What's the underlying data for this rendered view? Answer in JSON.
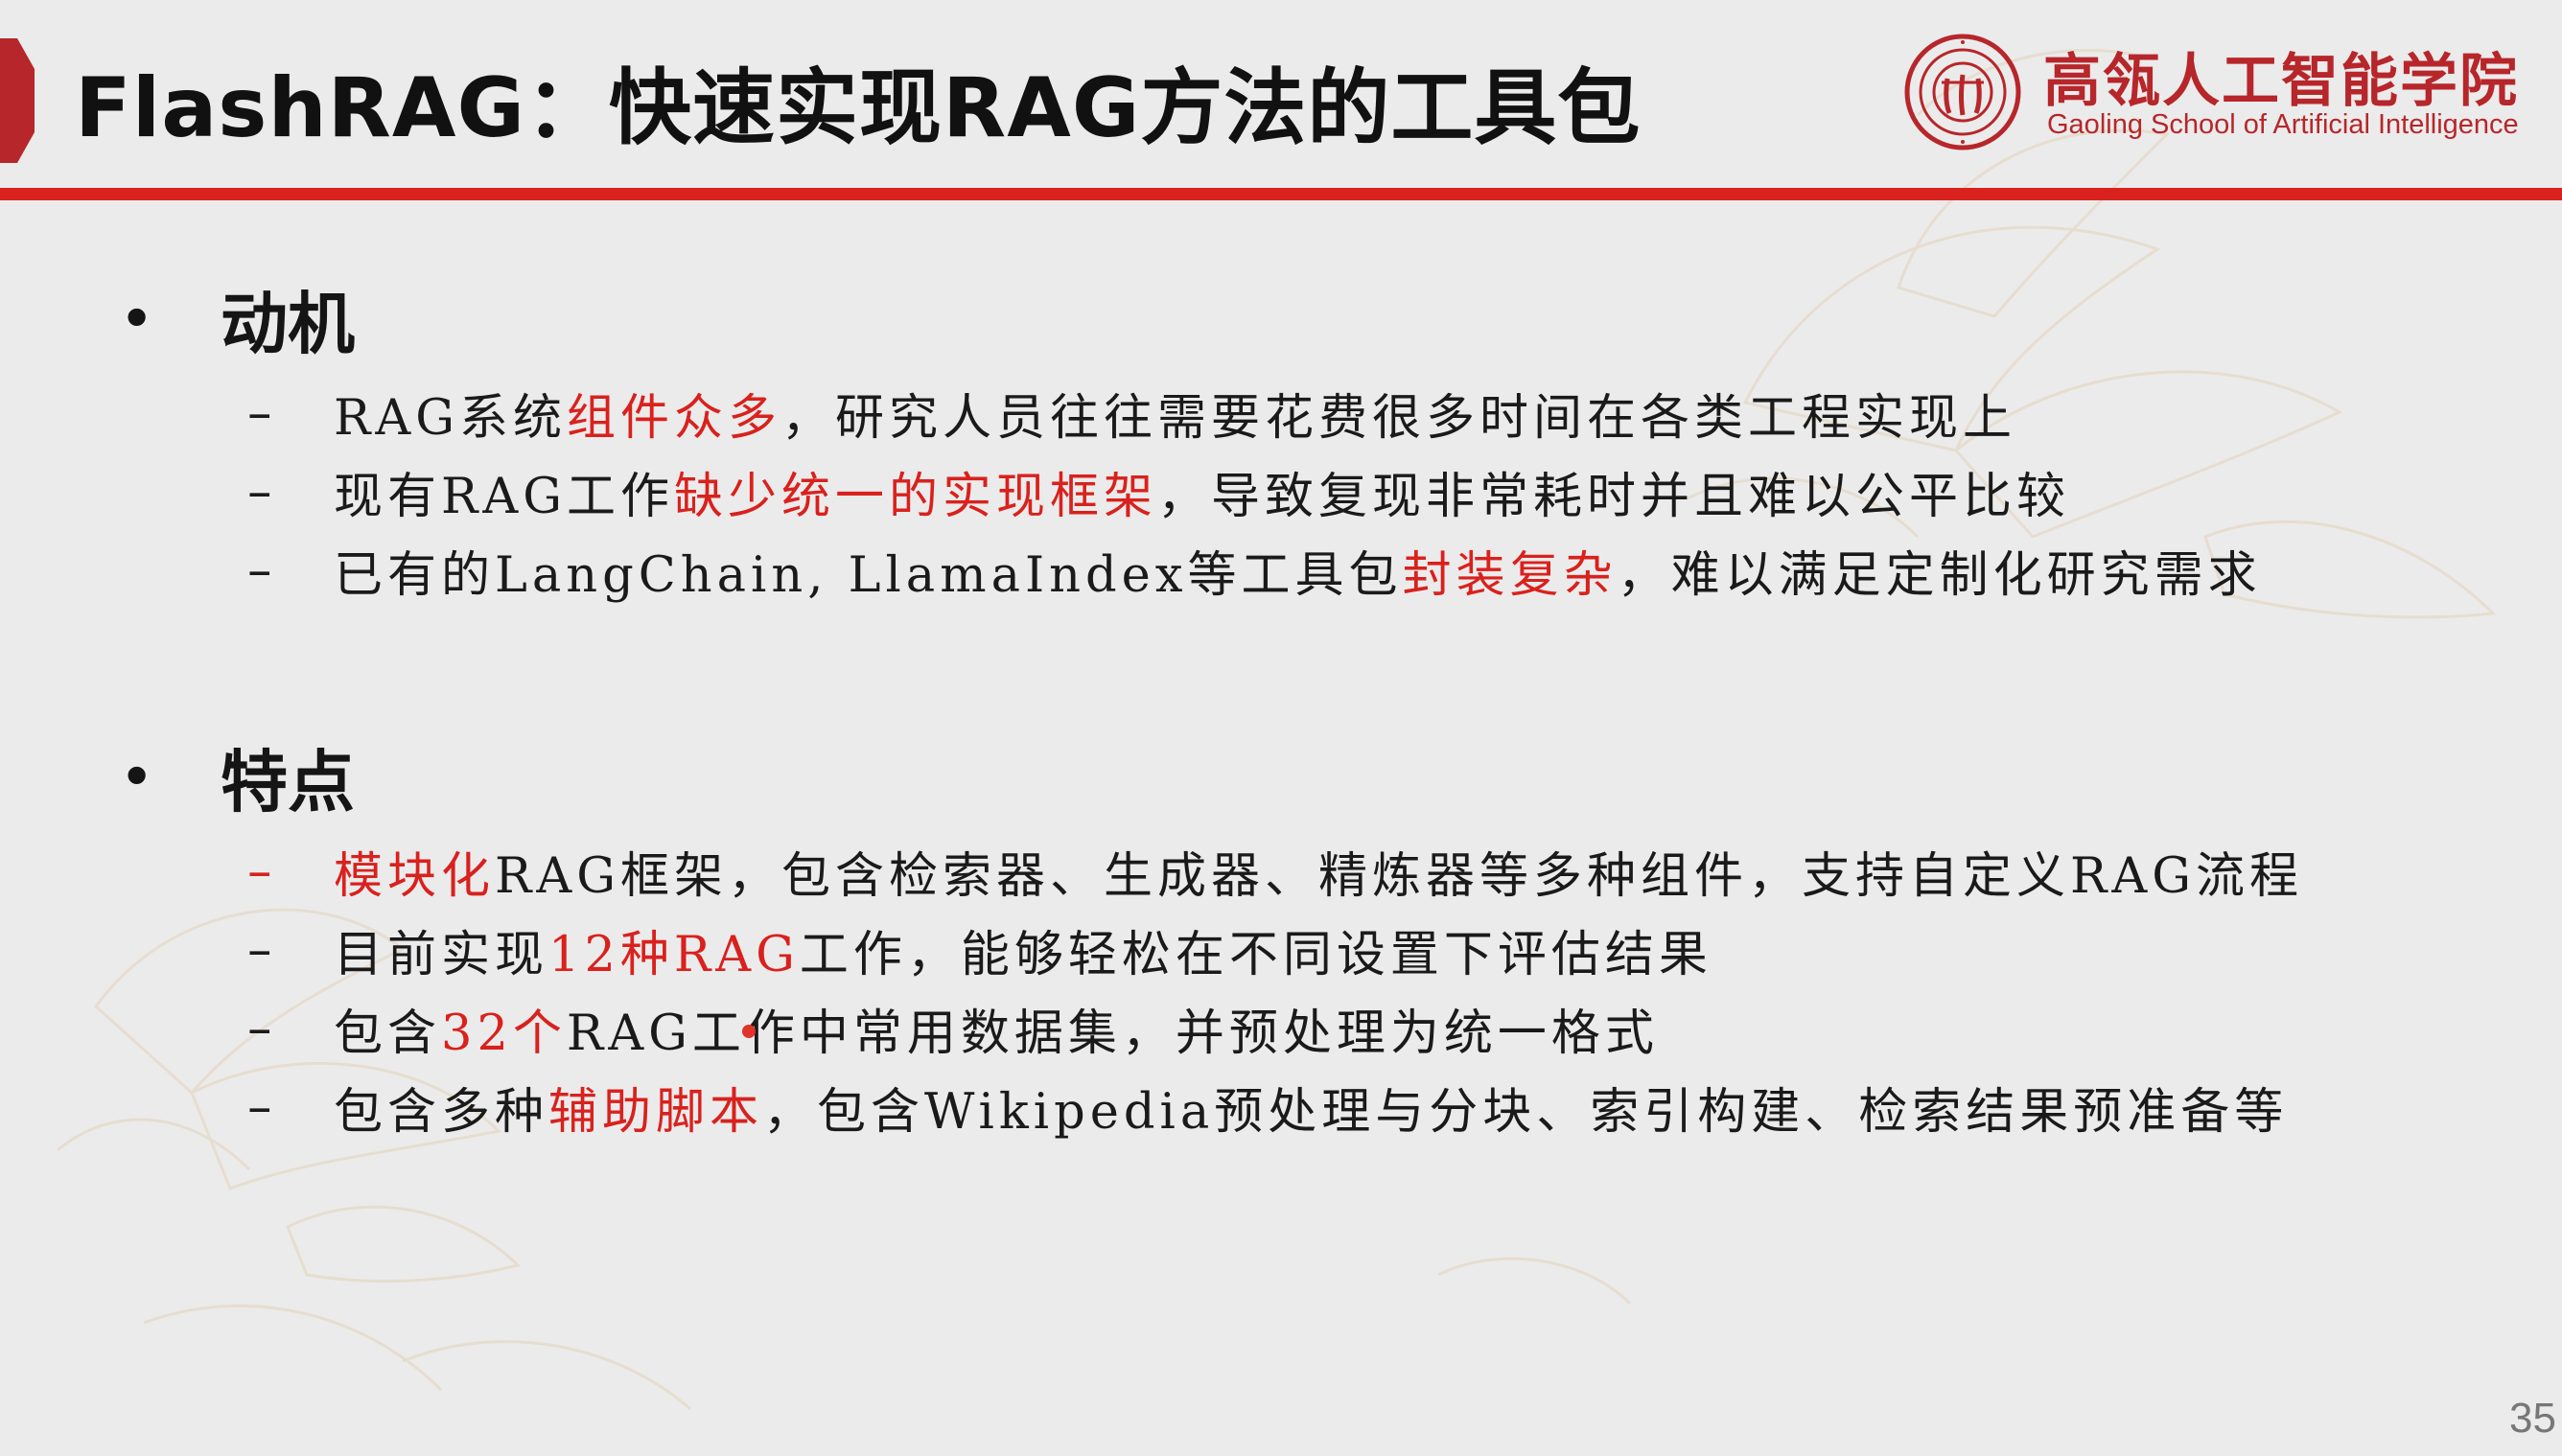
{
  "header": {
    "title": "FlashRAG：快速实现RAG方法的工具包",
    "logo_cn": "高瓴人工智能学院",
    "logo_en": "Gaoling School of Artificial Intelligence"
  },
  "sections": [
    {
      "heading": "动机",
      "items": [
        {
          "pre": "RAG系统",
          "hl": "组件众多",
          "post": "，研究人员往往需要花费很多时间在各类工程实现上"
        },
        {
          "pre": "现有RAG工作",
          "hl": "缺少统一的实现框架",
          "post": "，导致复现非常耗时并且难以公平比较"
        },
        {
          "pre": "已有的LangChain, LlamaIndex等工具包",
          "hl": "封装复杂",
          "post": "，难以满足定制化研究需求"
        }
      ]
    },
    {
      "heading": "特点",
      "items": [
        {
          "pre": "",
          "hl": "模块化",
          "post": "RAG框架，包含检索器、生成器、精炼器等多种组件，支持自定义RAG流程"
        },
        {
          "pre": "目前实现",
          "hl": "12种RAG",
          "post": "工作，能够轻松在不同设置下评估结果"
        },
        {
          "pre": "包含",
          "hl": "32个",
          "post": "RAG工作中常用数据集，并预处理为统一格式"
        },
        {
          "pre": "包含多种",
          "hl": "辅助脚本",
          "post": "，包含Wikipedia预处理与分块、索引构建、检索结果预准备等"
        }
      ]
    }
  ],
  "bullet_symbol": "•",
  "dash_symbol": "–",
  "page_number": "35",
  "colors": {
    "accent_red": "#d9211d",
    "logo_red": "#b7262a",
    "background": "#ebebeb"
  }
}
